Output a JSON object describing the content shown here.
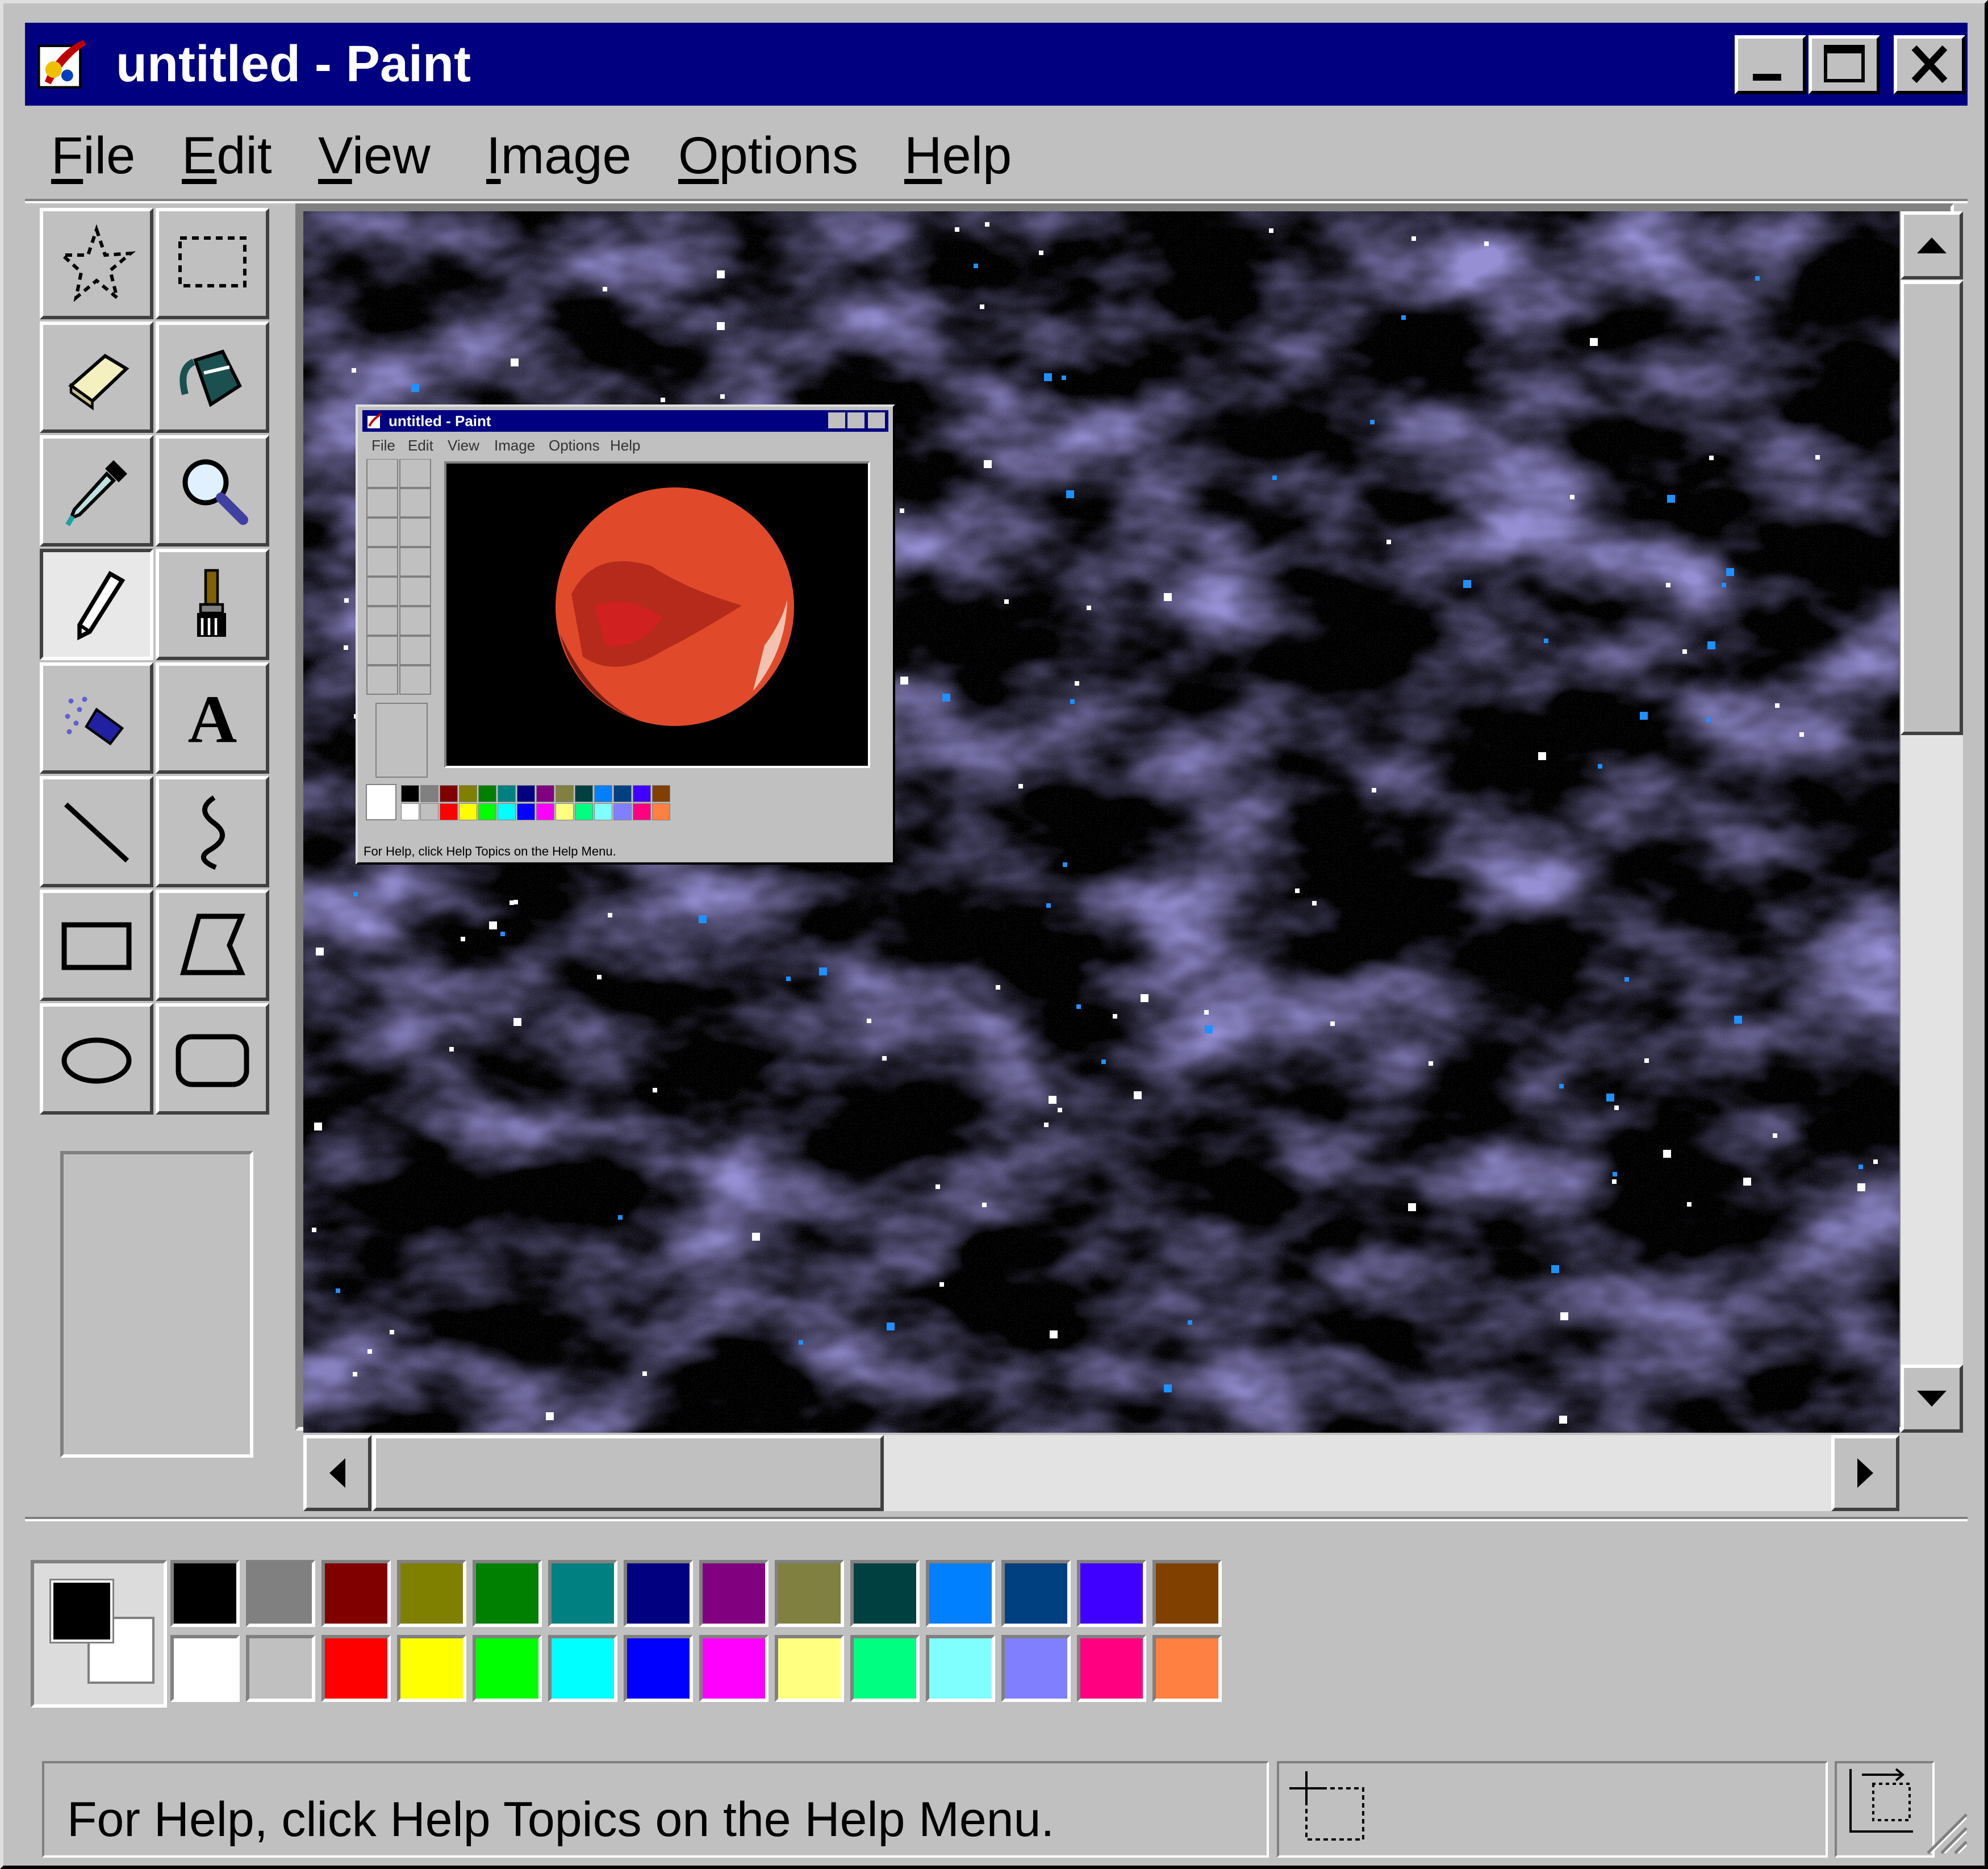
{
  "window": {
    "title": "untitled - Paint",
    "controls": [
      "minimize",
      "maximize",
      "close"
    ]
  },
  "menu": [
    {
      "label": "File",
      "mnemonic": "F",
      "rest": "ile"
    },
    {
      "label": "Edit",
      "mnemonic": "E",
      "rest": "dit"
    },
    {
      "label": "View",
      "mnemonic": "V",
      "rest": "iew"
    },
    {
      "label": "Image",
      "mnemonic": "I",
      "rest": "mage"
    },
    {
      "label": "Options",
      "mnemonic": "O",
      "rest": "ptions"
    },
    {
      "label": "Help",
      "mnemonic": "H",
      "rest": "elp"
    }
  ],
  "tools": [
    {
      "name": "free-form-select-tool",
      "icon": "free-form-select-icon"
    },
    {
      "name": "select-tool",
      "icon": "rect-select-icon"
    },
    {
      "name": "eraser-tool",
      "icon": "eraser-icon"
    },
    {
      "name": "fill-with-color-tool",
      "icon": "paint-bucket-icon"
    },
    {
      "name": "pick-color-tool",
      "icon": "eyedropper-icon"
    },
    {
      "name": "magnifier-tool",
      "icon": "magnifier-icon"
    },
    {
      "name": "pencil-tool",
      "icon": "pencil-icon",
      "selected": true
    },
    {
      "name": "brush-tool",
      "icon": "brush-icon"
    },
    {
      "name": "airbrush-tool",
      "icon": "airbrush-icon"
    },
    {
      "name": "text-tool",
      "icon": "text-icon",
      "glyph": "A"
    },
    {
      "name": "line-tool",
      "icon": "line-icon"
    },
    {
      "name": "curve-tool",
      "icon": "curve-icon"
    },
    {
      "name": "rectangle-tool",
      "icon": "rectangle-icon"
    },
    {
      "name": "polygon-tool",
      "icon": "polygon-icon"
    },
    {
      "name": "ellipse-tool",
      "icon": "ellipse-icon"
    },
    {
      "name": "rounded-rectangle-tool",
      "icon": "rounded-rectangle-icon"
    }
  ],
  "palette": {
    "foreground": "#000000",
    "background": "#ffffff",
    "top_row": [
      "#000000",
      "#808080",
      "#800000",
      "#808000",
      "#008000",
      "#008080",
      "#000080",
      "#800080",
      "#808040",
      "#004040",
      "#0080ff",
      "#004080",
      "#4000ff",
      "#804000"
    ],
    "bottom_row": [
      "#ffffff",
      "#c0c0c0",
      "#ff0000",
      "#ffff00",
      "#00ff00",
      "#00ffff",
      "#0000ff",
      "#ff00ff",
      "#ffff80",
      "#00ff80",
      "#80ffff",
      "#8080ff",
      "#ff0080",
      "#ff8040"
    ]
  },
  "canvas": {
    "background": "#000000",
    "nebula_color": "#5a4fb8",
    "star_color": "#ffffff",
    "accent_star_color": "#1e90ff"
  },
  "embedded_window": {
    "title": "untitled - Paint",
    "menu": [
      "File",
      "Edit",
      "View",
      "Image",
      "Options",
      "Help"
    ],
    "status": "For Help, click Help Topics on the Help Menu.",
    "planet_color": "#e04a2a"
  },
  "status": {
    "help_text": "For Help, click Help Topics on the Help Menu."
  }
}
